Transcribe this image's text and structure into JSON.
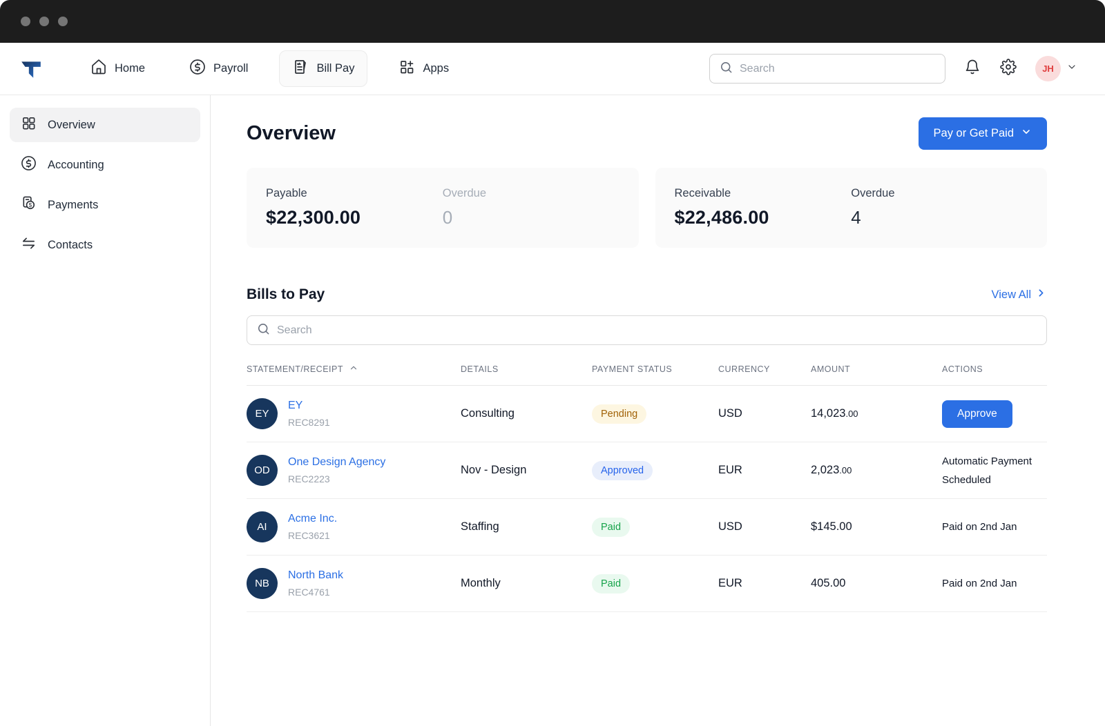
{
  "topnav": {
    "items": [
      {
        "label": "Home",
        "icon": "home-icon",
        "active": false
      },
      {
        "label": "Payroll",
        "icon": "dollar-circle-icon",
        "active": false
      },
      {
        "label": "Bill Pay",
        "icon": "bill-document-icon",
        "active": true
      },
      {
        "label": "Apps",
        "icon": "apps-grid-icon",
        "active": false
      }
    ],
    "search_placeholder": "Search",
    "avatar_initials": "JH"
  },
  "sidebar": {
    "items": [
      {
        "label": "Overview",
        "icon": "grid-icon",
        "active": true
      },
      {
        "label": "Accounting",
        "icon": "dollar-circle-icon",
        "active": false
      },
      {
        "label": "Payments",
        "icon": "receipt-dollar-icon",
        "active": false
      },
      {
        "label": "Contacts",
        "icon": "swap-arrows-icon",
        "active": false
      }
    ]
  },
  "main": {
    "page_title": "Overview",
    "primary_button_label": "Pay or Get Paid",
    "summary_cards": [
      {
        "label": "Payable",
        "value": "$22,300.00",
        "overdue_label": "Overdue",
        "overdue_value": "0",
        "overdue_muted": true
      },
      {
        "label": "Receivable",
        "value": "$22,486.00",
        "overdue_label": "Overdue",
        "overdue_value": "4",
        "overdue_muted": false
      }
    ],
    "bills": {
      "title": "Bills to Pay",
      "view_all_label": "View All",
      "search_placeholder": "Search",
      "columns": {
        "statement": "STATEMENT/RECEIPT",
        "details": "DETAILS",
        "status": "PAYMENT STATUS",
        "currency": "CURRENCY",
        "amount": "AMOUNT",
        "actions": "ACTIONS"
      },
      "rows": [
        {
          "initials": "EY",
          "name": "EY",
          "receipt": "REC8291",
          "details": "Consulting",
          "status": "Pending",
          "status_type": "pending",
          "currency": "USD",
          "amount_main": "14,023",
          "amount_cents": ".00",
          "action_label": "Approve"
        },
        {
          "initials": "OD",
          "name": "One Design Agency",
          "receipt": "REC2223",
          "details": "Nov - Design",
          "status": "Approved",
          "status_type": "approved",
          "currency": "EUR",
          "amount_main": "2,023",
          "amount_cents": ".00",
          "action_label": "Automatic Payment Scheduled"
        },
        {
          "initials": "AI",
          "name": "Acme Inc.",
          "receipt": "REC3621",
          "details": "Staffing",
          "status": "Paid",
          "status_type": "paid",
          "currency": "USD",
          "amount_main": "$145.00",
          "amount_cents": "",
          "action_label": "Paid on 2nd Jan"
        },
        {
          "initials": "NB",
          "name": "North Bank",
          "receipt": "REC4761",
          "details": "Monthly",
          "status": "Paid",
          "status_type": "paid",
          "currency": "EUR",
          "amount_main": "405.00",
          "amount_cents": "",
          "action_label": "Paid on 2nd Jan"
        }
      ]
    }
  },
  "colors": {
    "accent_blue": "#2b6fe4",
    "titlebar": "#1d1d1d",
    "avatar_navy": "#17365d",
    "pending_text": "#a16207",
    "pending_bg": "#fdf6e1",
    "approved_text": "#2563eb",
    "approved_bg": "#e8eefb",
    "paid_text": "#16a34a",
    "paid_bg": "#e9f9ef",
    "user_avatar_bg": "#fadcdc",
    "user_avatar_text": "#e03e3e"
  }
}
